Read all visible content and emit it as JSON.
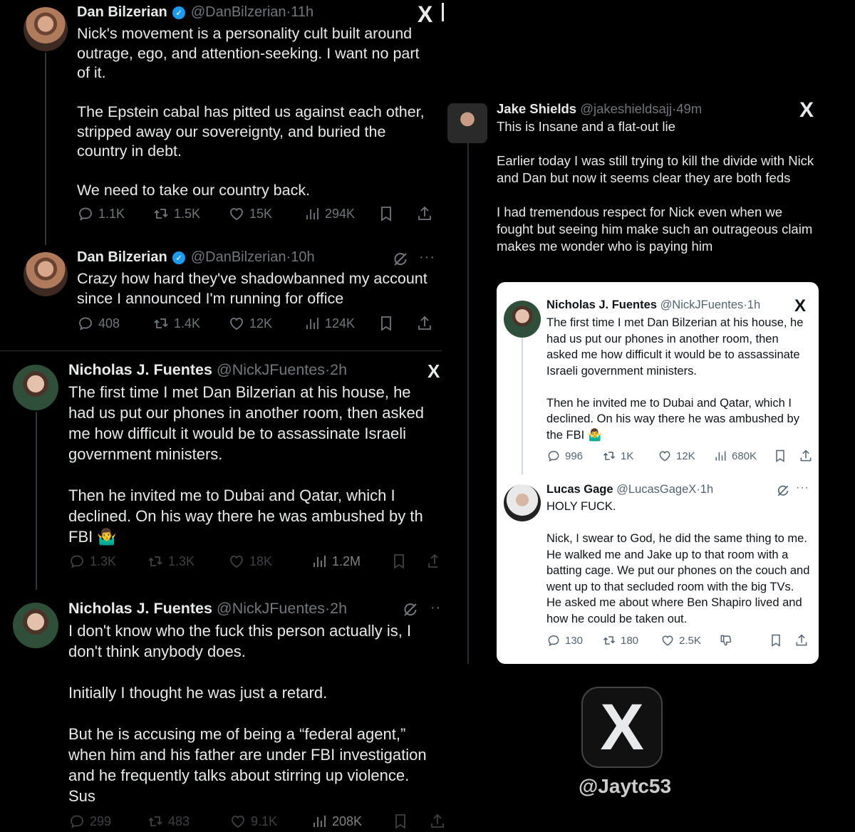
{
  "tweets": [
    {
      "name": "Dan Bilzerian",
      "handle": "@DanBilzerian",
      "time": "11h",
      "text": [
        "Nick's movement is a personality cult built around outrage, ego, and attention-seeking. I want no part of it.",
        "The Epstein cabal has pitted us against each other, stripped away our sovereignty, and buried the country in debt.",
        "We need to take our country back."
      ],
      "replies": "1.1K",
      "reposts": "1.5K",
      "likes": "15K",
      "views": "294K"
    },
    {
      "name": "Dan Bilzerian",
      "handle": "@DanBilzerian",
      "time": "10h",
      "text": [
        "Crazy how hard they've shadowbanned my account since I announced I'm running for office"
      ],
      "replies": "408",
      "reposts": "1.4K",
      "likes": "12K",
      "views": "124K"
    },
    {
      "name": "Nicholas J. Fuentes",
      "handle": "@NickJFuentes",
      "time": "2h",
      "text": [
        "The first time I met Dan Bilzerian at his house, he had us put our phones in another room, then asked me how difficult it would be to assassinate Israeli government ministers.",
        "Then he invited me to Dubai and Qatar, which I declined. On his way there he was ambushed by th FBI 🤷‍♂️"
      ],
      "replies": "1.3K",
      "reposts": "1.3K",
      "likes": "18K",
      "views": "1.2M"
    },
    {
      "name": "Nicholas J. Fuentes",
      "handle": "@NickJFuentes",
      "time": "2h",
      "text": [
        "I don't know who the fuck this person actually is, I don't think anybody does.",
        "Initially I thought he was just a retard.",
        "But he is accusing me of being a “federal agent,” when him and his father are under FBI investigation and he frequently talks about stirring up violence. Sus"
      ],
      "replies": "299",
      "reposts": "483",
      "likes": "9.1K",
      "views": "208K"
    }
  ],
  "jake": {
    "name": "Jake Shields",
    "handle": "@jakeshieldsajj",
    "time": "49m",
    "text": [
      "This is Insane and a flat-out lie",
      "Earlier today I was still trying to kill the divide with Nick and Dan but now it seems clear they are both feds",
      "I had tremendous respect for Nick even when we fought but seeing him make such an outrageous claim makes me wonder who is paying him"
    ]
  },
  "card": {
    "nick": {
      "name": "Nicholas J. Fuentes",
      "handle": "@NickJFuentes",
      "time": "1h",
      "text": [
        "The first time I met Dan Bilzerian at his house, he had us put our phones in another room, then asked me how difficult it would be to assassinate Israeli government ministers.",
        "Then he invited me to Dubai and Qatar, which I declined. On his way there he was ambushed by the FBI 🤷‍♂️"
      ],
      "replies": "996",
      "reposts": "1K",
      "likes": "12K",
      "views": "680K"
    },
    "lucas": {
      "name": "Lucas Gage",
      "handle": "@LucasGageX",
      "time": "1h",
      "text": [
        "HOLY FUCK.",
        "Nick, I swear to God, he did the same thing to me. He walked me and Jake up to that room with a batting cage. We put our phones on the couch and went up to that secluded room with the big TVs. He asked me about where Ben Shapiro lived and how he could be taken out."
      ],
      "replies": "130",
      "reposts": "180",
      "likes": "2.5K"
    }
  },
  "watermark": "@Jaytc53",
  "x_glyph": "X",
  "dot": "·",
  "more": "···"
}
